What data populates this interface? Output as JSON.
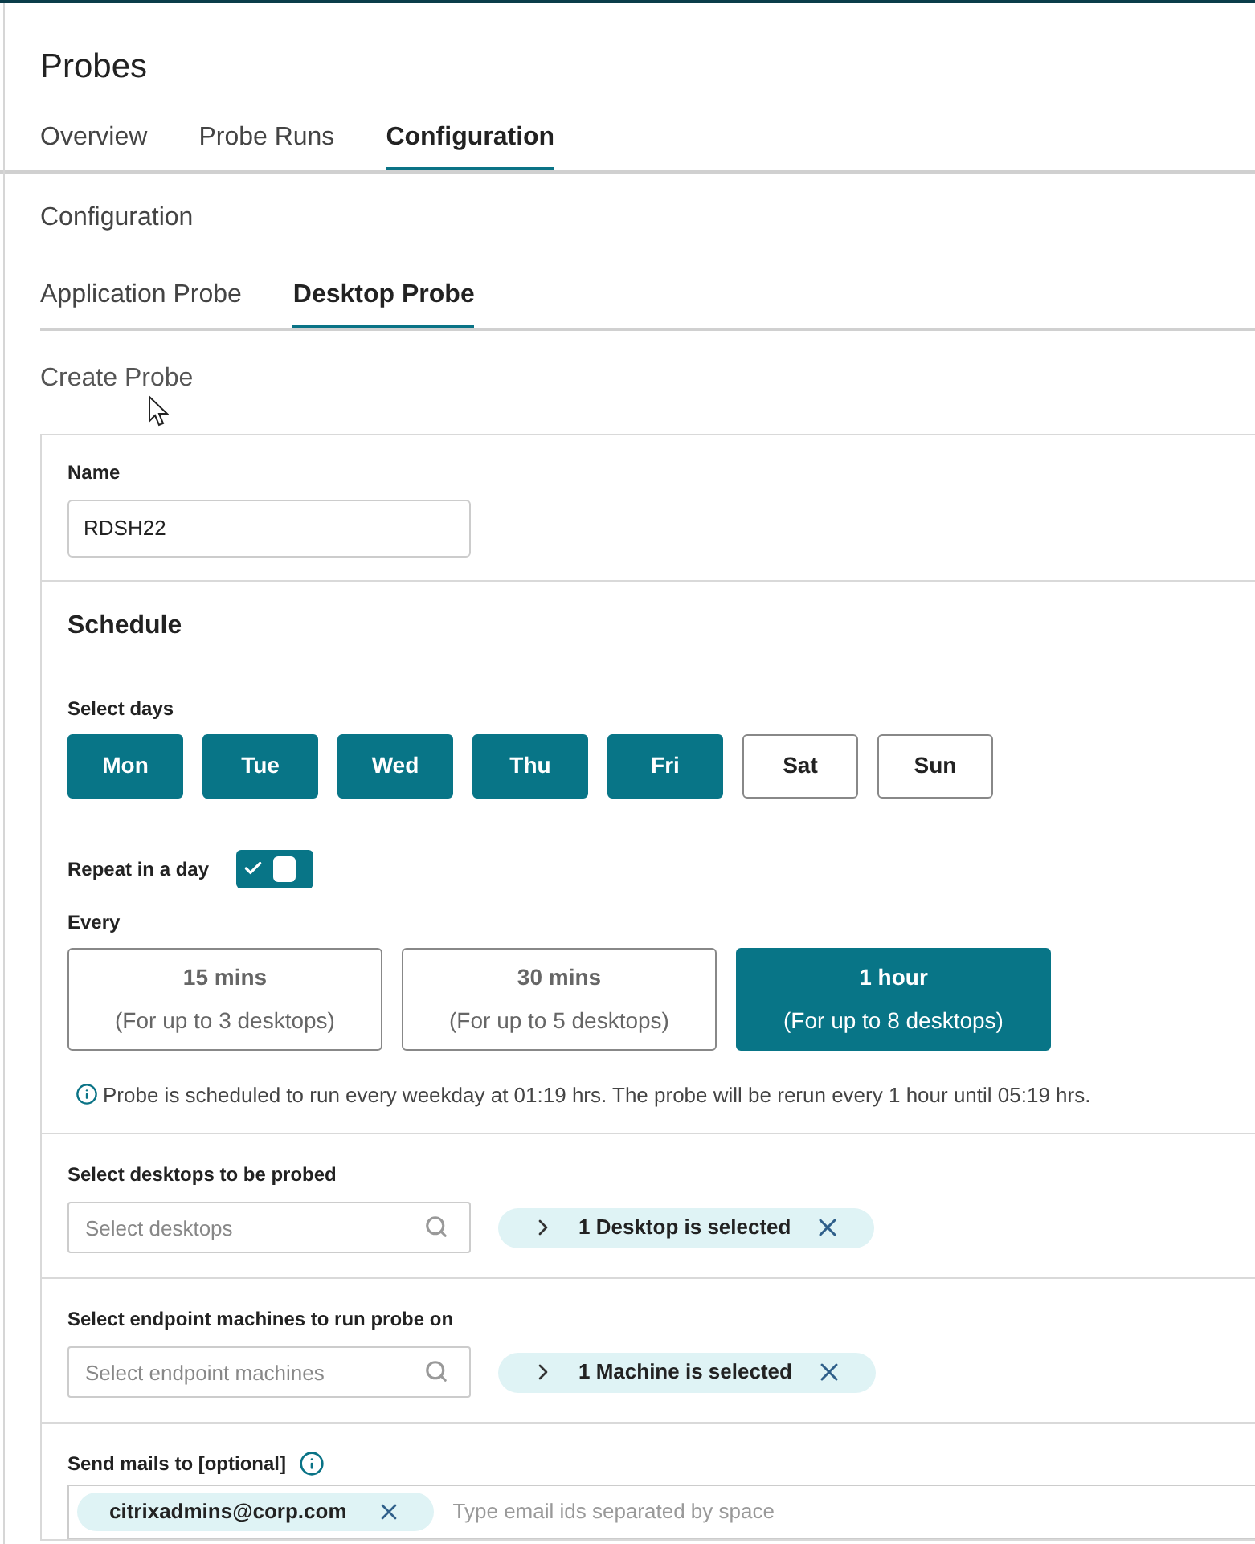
{
  "page": {
    "title": "Probes"
  },
  "tabs": [
    {
      "label": "Overview",
      "selected": false
    },
    {
      "label": "Probe Runs",
      "selected": false
    },
    {
      "label": "Configuration",
      "selected": true
    }
  ],
  "section_title": "Configuration",
  "sub_tabs": [
    {
      "label": "Application Probe",
      "selected": false
    },
    {
      "label": "Desktop Probe",
      "selected": true
    }
  ],
  "create_title": "Create Probe",
  "name_field": {
    "label": "Name",
    "value": "RDSH22"
  },
  "schedule": {
    "title": "Schedule",
    "days_label": "Select days",
    "days": [
      {
        "label": "Mon",
        "selected": true
      },
      {
        "label": "Tue",
        "selected": true
      },
      {
        "label": "Wed",
        "selected": true
      },
      {
        "label": "Thu",
        "selected": true
      },
      {
        "label": "Fri",
        "selected": true
      },
      {
        "label": "Sat",
        "selected": false
      },
      {
        "label": "Sun",
        "selected": false
      }
    ],
    "repeat": {
      "label": "Repeat in a day",
      "on": true
    },
    "every_label": "Every",
    "intervals": [
      {
        "label": "15 mins",
        "note": "(For up to 3 desktops)",
        "selected": false
      },
      {
        "label": "30 mins",
        "note": "(For up to 5 desktops)",
        "selected": false
      },
      {
        "label": "1 hour",
        "note": "(For up to 8 desktops)",
        "selected": true
      }
    ],
    "info": "Probe is scheduled to run every weekday at 01:19 hrs. The probe will be rerun every 1 hour until 05:19 hrs."
  },
  "selectors": [
    {
      "label": "Select desktops to be probed",
      "placeholder": "Select desktops",
      "chip": "1 Desktop is selected"
    },
    {
      "label": "Select endpoint machines to run probe on",
      "placeholder": "Select endpoint machines",
      "chip": "1 Machine is selected"
    }
  ],
  "mail": {
    "label": "Send mails to [optional]",
    "chips": [
      "citrixadmins@corp.com"
    ],
    "placeholder": "Type email ids separated by space"
  }
}
